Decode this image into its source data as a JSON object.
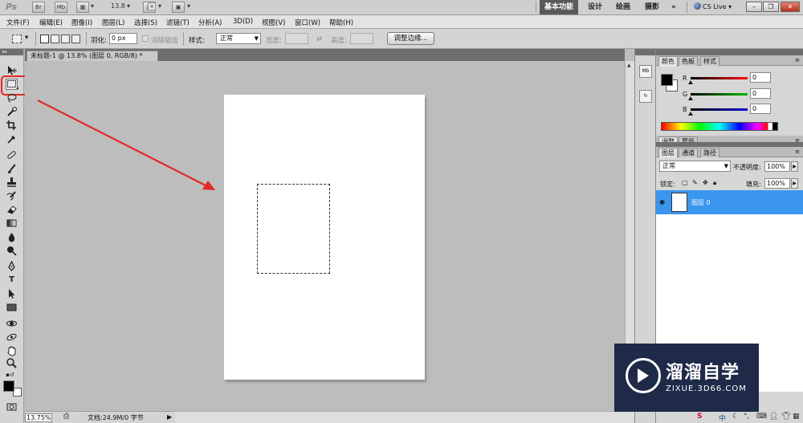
{
  "appbar": {
    "logo": "Ps",
    "mb_label": "Mb",
    "zoom": "13.8",
    "workspaces": [
      "基本功能",
      "设计",
      "绘画",
      "摄影"
    ],
    "more": "»",
    "cslive": "CS Live"
  },
  "menu": [
    "文件(F)",
    "编辑(E)",
    "图像(I)",
    "图层(L)",
    "选择(S)",
    "滤镜(T)",
    "分析(A)",
    "3D(D)",
    "视图(V)",
    "窗口(W)",
    "帮助(H)"
  ],
  "options": {
    "feather_label": "羽化:",
    "feather_value": "0 px",
    "antialias_label": "消除锯齿",
    "style_label": "样式:",
    "style_value": "正常",
    "width_label": "宽度:",
    "height_label": "高度:",
    "refine_button": "调整边缘..."
  },
  "document": {
    "tab_title": "未标题-1 @ 13.8% (图层 0, RGB/8) *",
    "close": "×"
  },
  "status": {
    "zoom": "13.75%",
    "info": "文档:24.9M/0 字节"
  },
  "color_panel": {
    "tabs": [
      "颜色",
      "色板",
      "样式"
    ],
    "channels": [
      {
        "label": "R",
        "value": "0",
        "color": "#d01818"
      },
      {
        "label": "G",
        "value": "0",
        "color": "#18a018"
      },
      {
        "label": "B",
        "value": "0",
        "color": "#1818c8"
      }
    ]
  },
  "adjust_panel": {
    "tabs": [
      "调整",
      "蒙版"
    ]
  },
  "layers_panel": {
    "tabs": [
      "图层",
      "通道",
      "路径"
    ],
    "blend_mode": "正常",
    "opacity_label": "不透明度:",
    "opacity_value": "100%",
    "lock_label": "锁定:",
    "fill_label": "填充:",
    "fill_value": "100%",
    "layer_name": "图层 0"
  },
  "watermark": {
    "name": "溜溜自学",
    "url": "ZIXUE.3D66.COM"
  },
  "tray": {
    "ime": "中"
  },
  "colors": {
    "selection_blue": "#3a96ee",
    "highlight_red": "#e42626"
  }
}
